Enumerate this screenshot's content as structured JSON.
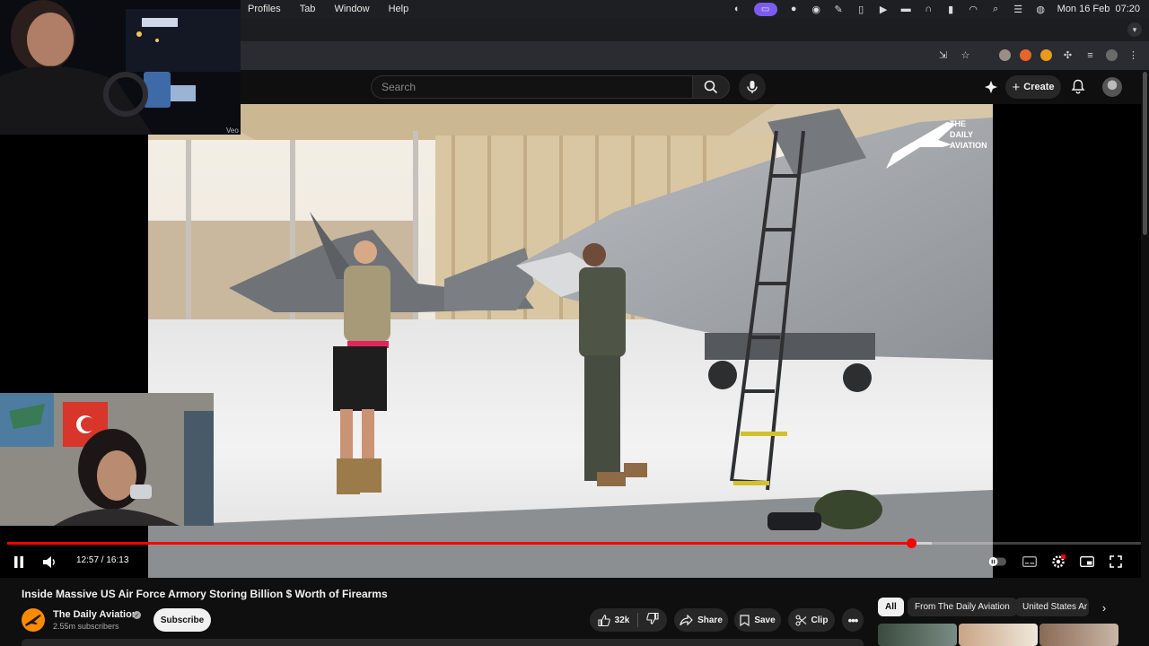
{
  "menubar": {
    "items": [
      "Profiles",
      "Tab",
      "Window",
      "Help"
    ],
    "clock": "Mon 16 Feb  07:20"
  },
  "youtube": {
    "search_placeholder": "Search",
    "create_label": "Create"
  },
  "player": {
    "current_time": "12:57",
    "duration": "16:13",
    "time_display": "12:57 / 16:13",
    "progress_fraction": 0.797,
    "buffered_fraction": 0.815,
    "watermark_lines": [
      "THE",
      "DAILY",
      "AVIATION"
    ],
    "cam1_label": "Veo"
  },
  "video": {
    "title": "Inside Massive US Air Force Armory Storing Billion $ Worth of Firearms",
    "channel_name": "The Daily Aviation",
    "subscribers": "2.55m subscribers",
    "subscribe_label": "Subscribe",
    "likes": "32k",
    "share_label": "Share",
    "save_label": "Save",
    "clip_label": "Clip"
  },
  "chips": [
    "All",
    "From The Daily Aviation",
    "United States Ar"
  ],
  "colors": {
    "accent_red": "#ff0000",
    "background": "#0f0f0f",
    "pill": "#272727",
    "subscribe_bg": "#f1f1f1"
  },
  "icons": {
    "search": "search-icon",
    "mic": "microphone-icon",
    "bell": "bell-icon",
    "create": "plus-icon",
    "pause": "pause-icon",
    "volume": "volume-icon",
    "settings": "gear-icon",
    "fullscreen": "fullscreen-icon"
  }
}
